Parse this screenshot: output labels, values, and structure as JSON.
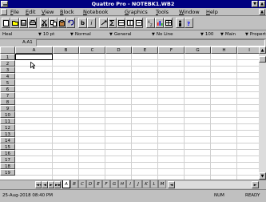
{
  "window": {
    "title": "Quattro Pro - NOTEBK1.WB2",
    "minimize_glyph": "▼",
    "maximize_glyph": "▲",
    "doc_minimize_glyph": "▼",
    "doc_maximize_glyph": "▲"
  },
  "menu": {
    "items": [
      "File",
      "Edit",
      "View",
      "Block",
      "Notebook",
      "Graphics",
      "Tools",
      "Window",
      "Help"
    ]
  },
  "toolbar": {
    "buttons": [
      {
        "icon": "new-notebook-icon"
      },
      {
        "icon": "open-icon"
      },
      {
        "icon": "save-icon"
      },
      {
        "icon": "print-icon"
      },
      {
        "icon": "cut-icon"
      },
      {
        "icon": "copy-icon"
      },
      {
        "icon": "paste-icon"
      },
      {
        "icon": "undo-icon"
      },
      {
        "icon": "bold-icon",
        "label": "b"
      },
      {
        "icon": "italic-icon",
        "label": "i"
      },
      {
        "icon": "speedfill-icon"
      },
      {
        "icon": "speedsum-icon"
      },
      {
        "icon": "insert-icon"
      },
      {
        "icon": "delete-icon"
      },
      {
        "icon": "fit-icon"
      },
      {
        "icon": "sort-icon"
      },
      {
        "icon": "graph-icon"
      },
      {
        "icon": "table-icon"
      },
      {
        "icon": "expert-icon"
      },
      {
        "icon": "help-icon"
      }
    ]
  },
  "property_band": {
    "style": "Heal",
    "font": "10 pt",
    "normal": "Normal",
    "numeric": "General",
    "line": "No Line",
    "align": "100",
    "main": "Main",
    "property": "Propert"
  },
  "input_line": {
    "cell_ref": "A:A1",
    "value": ""
  },
  "grid": {
    "columns": [
      "A",
      "B",
      "C",
      "D",
      "E",
      "F",
      "G",
      "H",
      "I"
    ],
    "rows": [
      "1",
      "2",
      "3",
      "4",
      "5",
      "6",
      "7",
      "8",
      "9",
      "10",
      "11",
      "12",
      "13",
      "14",
      "15",
      "16",
      "17",
      "18",
      "19"
    ],
    "active_cell": "A1"
  },
  "tabs": {
    "nav": [
      "◄◄",
      "◄",
      "►",
      "►►"
    ],
    "sheets": [
      "A",
      "B",
      "C",
      "D",
      "E",
      "F",
      "G",
      "H",
      "I",
      "J",
      "K",
      "L",
      "M"
    ],
    "active_sheet": "A"
  },
  "status": {
    "datetime": "25-Aug-2018 08:40 PM",
    "num": "NUM",
    "ready": "READY"
  },
  "colors": {
    "title_bar": "#000080",
    "chrome": "#c0c0c0",
    "grid_bg": "#ffffff",
    "gridline": "#d0d0d0"
  }
}
